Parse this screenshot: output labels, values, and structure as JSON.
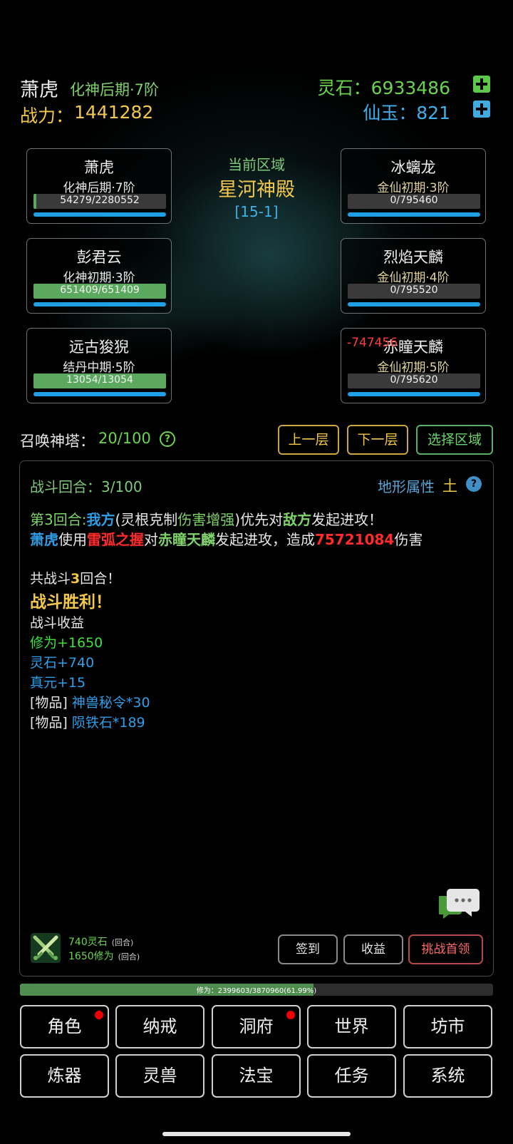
{
  "header": {
    "player_name": "萧虎",
    "player_realm": "化神后期·7阶",
    "power_label": "战力：",
    "power_value": "1441282",
    "spirit_stone": "灵石：6933486",
    "immortal_jade": "仙玉：821"
  },
  "zone": {
    "label": "当前区域",
    "name": "星河神殿",
    "code": "[15-1]"
  },
  "allies": [
    {
      "name": "萧虎",
      "realm": "化神后期·7阶",
      "hp_text": "54279/2280552",
      "hp_fraction": 0.024
    },
    {
      "name": "彭君云",
      "realm": "化神初期·3阶",
      "hp_text": "651409/651409",
      "hp_fraction": 1.0
    },
    {
      "name": "远古狻猊",
      "realm": "结丹中期·5阶",
      "hp_text": "13054/13054",
      "hp_fraction": 1.0
    }
  ],
  "enemies": [
    {
      "name": "冰螭龙",
      "realm": "金仙初期·3阶",
      "hp_text": "0/795460",
      "hp_fraction": 0
    },
    {
      "name": "烈焰天麟",
      "realm": "金仙初期·4阶",
      "hp_text": "0/795520",
      "hp_fraction": 0
    },
    {
      "name": "赤瞳天麟",
      "realm": "金仙初期·5阶",
      "hp_text": "0/795620",
      "hp_fraction": 0,
      "damage_float": "-747456"
    }
  ],
  "tower": {
    "label": "召唤神塔：",
    "value": "20/100",
    "help": "?"
  },
  "floor_buttons": {
    "up": "上一层",
    "down": "下一层",
    "select": "选择区域"
  },
  "battle": {
    "round_label": "战斗回合：",
    "round_value": "3/100",
    "terrain_label": "地形属性",
    "terrain_value": "土",
    "terrain_help": "?",
    "line1": {
      "a": "第3回合:",
      "b": "我方",
      "c": "(灵根克制",
      "d": "伤害增强",
      "e": ")优先对",
      "f": "敌方",
      "g": "发起进攻！"
    },
    "line2": {
      "a": "萧虎",
      "b": "使用",
      "c": "雷弧之握",
      "d": "对",
      "e": "赤瞳天麟",
      "f": "发起进攻，造成",
      "g": "75721084",
      "h": "伤害"
    },
    "summary": {
      "a": "共战斗",
      "b": "3",
      "c": "回合！"
    },
    "victory": "战斗胜利！",
    "income_label": "战斗收益",
    "income_cultivation": "修为+1650",
    "income_stone": "灵石+740",
    "income_yuan": "真元+15",
    "item1_tag": "[物品]",
    "item1_name": "神兽秘令*30",
    "item2_tag": "[物品]",
    "item2_name": "陨铁石*189"
  },
  "round_reward": {
    "stone": "740灵石",
    "cultivation": "1650修为",
    "unit": "(回合)"
  },
  "action_buttons": {
    "signin": "签到",
    "income": "收益",
    "boss": "挑战首领"
  },
  "cultivation_progress": {
    "text": "修为：2399603/3870960(61.99%)",
    "fraction": 0.6199
  },
  "nav": [
    {
      "label": "角色",
      "badge": true
    },
    {
      "label": "纳戒",
      "badge": false
    },
    {
      "label": "洞府",
      "badge": true
    },
    {
      "label": "世界",
      "badge": false
    },
    {
      "label": "坊市",
      "badge": false
    },
    {
      "label": "炼器",
      "badge": false
    },
    {
      "label": "灵兽",
      "badge": false
    },
    {
      "label": "法宝",
      "badge": false
    },
    {
      "label": "任务",
      "badge": false
    },
    {
      "label": "系统",
      "badge": false
    }
  ]
}
